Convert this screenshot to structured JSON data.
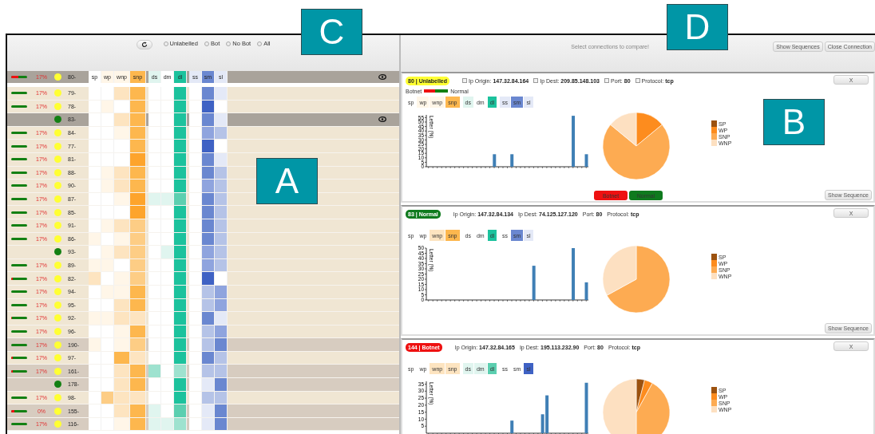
{
  "callouts": [
    {
      "label": "C"
    },
    {
      "label": "D"
    },
    {
      "label": "A"
    },
    {
      "label": "B"
    }
  ],
  "filter_bar": {
    "radios": [
      {
        "label": "Unlabelled",
        "selected": false
      },
      {
        "label": "Bot",
        "selected": false
      },
      {
        "label": "No Bot",
        "selected": false
      },
      {
        "label": "All",
        "selected": false
      }
    ]
  },
  "header_row": {
    "id": "80-",
    "percent": "17%",
    "vote": {
      "level": 0.45
    },
    "color": "#ffff33",
    "columns": [
      {
        "label": "sp",
        "color": "#ffffff"
      },
      {
        "label": "wp",
        "color": "#fff6e8"
      },
      {
        "label": "wnp",
        "color": "#fff6e8"
      },
      {
        "label": "snp",
        "color": "#fdb74e"
      },
      {
        "label": "ds",
        "color": "#e0f5ef"
      },
      {
        "label": "dm",
        "color": "#ffffff"
      },
      {
        "label": "dl",
        "color": "#1cc29d"
      },
      {
        "label": "ss",
        "color": "#e4e9f7"
      },
      {
        "label": "sm",
        "color": "#6a87d0"
      },
      {
        "label": "sl",
        "color": "#e4e9f7"
      }
    ]
  },
  "rows": [
    {
      "id": "79-",
      "percent": "17%",
      "vote": {
        "level": 0
      },
      "color": "#ffff33",
      "highlighted": false,
      "selected": false,
      "cells": [
        {
          "color": "#ffffff"
        },
        {
          "color": "#ffffff"
        },
        {
          "color": "#fde4c0"
        },
        {
          "color": "#fdb74e"
        },
        {
          "color": "#ffffff"
        },
        {
          "color": "#ffffff"
        },
        {
          "color": "#1cc29d"
        },
        {
          "color": "#ffffff"
        },
        {
          "color": "#6a87d0"
        },
        {
          "color": "#e4e9f7"
        }
      ]
    },
    {
      "id": "78-",
      "percent": "17%",
      "vote": {
        "level": 0
      },
      "color": "#ffff33",
      "highlighted": false,
      "selected": false,
      "cells": [
        {
          "color": "#ffffff"
        },
        {
          "color": "#fff6e8"
        },
        {
          "color": "#ffffff"
        },
        {
          "color": "#fdb74e"
        },
        {
          "color": "#ffffff"
        },
        {
          "color": "#ffffff"
        },
        {
          "color": "#1cc29d"
        },
        {
          "color": "#ffffff"
        },
        {
          "color": "#3f62c4"
        },
        {
          "color": "#ffffff"
        }
      ]
    },
    {
      "id": "83-",
      "color": "#138013",
      "highlighted": false,
      "selected": true,
      "cells": [
        {
          "color": "#ffffff"
        },
        {
          "color": "#ffffff"
        },
        {
          "color": "#fde4c0"
        },
        {
          "color": "#fdb74e"
        },
        {
          "color": "#ffffff"
        },
        {
          "color": "#ffffff"
        },
        {
          "color": "#1cc29d"
        },
        {
          "color": "#ffffff"
        },
        {
          "color": "#6a87d0"
        },
        {
          "color": "#e4e9f7"
        }
      ]
    },
    {
      "id": "84-",
      "percent": "17%",
      "vote": {
        "level": 0
      },
      "color": "#ffff33",
      "highlighted": false,
      "selected": false,
      "cells": [
        {
          "color": "#ffffff"
        },
        {
          "color": "#ffffff"
        },
        {
          "color": "#fff6e8"
        },
        {
          "color": "#fdb74e"
        },
        {
          "color": "#ffffff"
        },
        {
          "color": "#ffffff"
        },
        {
          "color": "#1cc29d"
        },
        {
          "color": "#ffffff"
        },
        {
          "color": "#8fa4de"
        },
        {
          "color": "#b5c3e7"
        }
      ]
    },
    {
      "id": "77-",
      "percent": "17%",
      "vote": {
        "level": 0
      },
      "color": "#ffff33",
      "highlighted": false,
      "selected": false,
      "cells": [
        {
          "color": "#ffffff"
        },
        {
          "color": "#ffffff"
        },
        {
          "color": "#ffffff"
        },
        {
          "color": "#fdb74e"
        },
        {
          "color": "#ffffff"
        },
        {
          "color": "#ffffff"
        },
        {
          "color": "#1cc29d"
        },
        {
          "color": "#ffffff"
        },
        {
          "color": "#3f62c4"
        },
        {
          "color": "#ffffff"
        }
      ]
    },
    {
      "id": "81-",
      "percent": "17%",
      "vote": {
        "level": 0
      },
      "color": "#ffff33",
      "highlighted": false,
      "selected": false,
      "cells": [
        {
          "color": "#ffffff"
        },
        {
          "color": "#ffffff"
        },
        {
          "color": "#ffffff"
        },
        {
          "color": "#fda42c"
        },
        {
          "color": "#ffffff"
        },
        {
          "color": "#ffffff"
        },
        {
          "color": "#1cc29d"
        },
        {
          "color": "#ffffff"
        },
        {
          "color": "#6a87d0"
        },
        {
          "color": "#e4e9f7"
        }
      ]
    },
    {
      "id": "88-",
      "percent": "17%",
      "vote": {
        "level": 0
      },
      "color": "#ffff33",
      "highlighted": false,
      "selected": false,
      "cells": [
        {
          "color": "#ffffff"
        },
        {
          "color": "#fff6e8"
        },
        {
          "color": "#fde4c0"
        },
        {
          "color": "#fdb74e"
        },
        {
          "color": "#ffffff"
        },
        {
          "color": "#ffffff"
        },
        {
          "color": "#1cc29d"
        },
        {
          "color": "#ffffff"
        },
        {
          "color": "#6a87d0"
        },
        {
          "color": "#b5c3e7"
        }
      ]
    },
    {
      "id": "90-",
      "percent": "17%",
      "vote": {
        "level": 0
      },
      "color": "#ffff33",
      "highlighted": false,
      "selected": false,
      "cells": [
        {
          "color": "#ffffff"
        },
        {
          "color": "#fff6e8"
        },
        {
          "color": "#fde4c0"
        },
        {
          "color": "#fdb74e"
        },
        {
          "color": "#ffffff"
        },
        {
          "color": "#ffffff"
        },
        {
          "color": "#1cc29d"
        },
        {
          "color": "#ffffff"
        },
        {
          "color": "#8fa4de"
        },
        {
          "color": "#b5c3e7"
        }
      ]
    },
    {
      "id": "87-",
      "percent": "17%",
      "vote": {
        "level": 0
      },
      "color": "#ffff33",
      "highlighted": false,
      "selected": false,
      "cells": [
        {
          "color": "#ffffff"
        },
        {
          "color": "#ffffff"
        },
        {
          "color": "#fff6e8"
        },
        {
          "color": "#fda42c"
        },
        {
          "color": "#e0f5ef"
        },
        {
          "color": "#e0f5ef"
        },
        {
          "color": "#5ccfb0"
        },
        {
          "color": "#ffffff"
        },
        {
          "color": "#6a87d0"
        },
        {
          "color": "#b5c3e7"
        }
      ]
    },
    {
      "id": "85-",
      "percent": "17%",
      "vote": {
        "level": 0
      },
      "color": "#ffff33",
      "highlighted": false,
      "selected": false,
      "cells": [
        {
          "color": "#ffffff"
        },
        {
          "color": "#ffffff"
        },
        {
          "color": "#ffffff"
        },
        {
          "color": "#fda42c"
        },
        {
          "color": "#ffffff"
        },
        {
          "color": "#ffffff"
        },
        {
          "color": "#1cc29d"
        },
        {
          "color": "#ffffff"
        },
        {
          "color": "#6a87d0"
        },
        {
          "color": "#b5c3e7"
        }
      ]
    },
    {
      "id": "91-",
      "percent": "17%",
      "vote": {
        "level": 0
      },
      "color": "#ffff33",
      "highlighted": false,
      "selected": false,
      "cells": [
        {
          "color": "#ffffff"
        },
        {
          "color": "#fff6e8"
        },
        {
          "color": "#fde4c0"
        },
        {
          "color": "#fdcd85"
        },
        {
          "color": "#ffffff"
        },
        {
          "color": "#ffffff"
        },
        {
          "color": "#1cc29d"
        },
        {
          "color": "#ffffff"
        },
        {
          "color": "#6a87d0"
        },
        {
          "color": "#b5c3e7"
        }
      ]
    },
    {
      "id": "86-",
      "percent": "17%",
      "vote": {
        "level": 0
      },
      "color": "#ffff33",
      "highlighted": false,
      "selected": false,
      "cells": [
        {
          "color": "#fff6e8"
        },
        {
          "color": "#ffffff"
        },
        {
          "color": "#fff6e8"
        },
        {
          "color": "#fdcd85"
        },
        {
          "color": "#ffffff"
        },
        {
          "color": "#ffffff"
        },
        {
          "color": "#1cc29d"
        },
        {
          "color": "#ffffff"
        },
        {
          "color": "#6a87d0"
        },
        {
          "color": "#b5c3e7"
        }
      ]
    },
    {
      "id": "93-",
      "color": "#138013",
      "highlighted": false,
      "selected": false,
      "cells": [
        {
          "color": "#ffffff"
        },
        {
          "color": "#fff6e8"
        },
        {
          "color": "#fde4c0"
        },
        {
          "color": "#fdcd85"
        },
        {
          "color": "#ffffff"
        },
        {
          "color": "#e0f5ef"
        },
        {
          "color": "#1cc29d"
        },
        {
          "color": "#ffffff"
        },
        {
          "color": "#8fa4de"
        },
        {
          "color": "#b5c3e7"
        }
      ]
    },
    {
      "id": "89-",
      "percent": "17%",
      "vote": {
        "level": 0
      },
      "color": "#ffff33",
      "highlighted": false,
      "selected": false,
      "cells": [
        {
          "color": "#fff6e8"
        },
        {
          "color": "#fff6e8"
        },
        {
          "color": "#ffffff"
        },
        {
          "color": "#fdcd85"
        },
        {
          "color": "#ffffff"
        },
        {
          "color": "#ffffff"
        },
        {
          "color": "#1cc29d"
        },
        {
          "color": "#ffffff"
        },
        {
          "color": "#8fa4de"
        },
        {
          "color": "#b5c3e7"
        }
      ]
    },
    {
      "id": "82-",
      "percent": "17%",
      "vote": {
        "level": 0.1
      },
      "color": "#ffff33",
      "highlighted": false,
      "selected": false,
      "cells": [
        {
          "color": "#fde4c0"
        },
        {
          "color": "#ffffff"
        },
        {
          "color": "#fff6e8"
        },
        {
          "color": "#fdcd85"
        },
        {
          "color": "#ffffff"
        },
        {
          "color": "#ffffff"
        },
        {
          "color": "#1cc29d"
        },
        {
          "color": "#ffffff"
        },
        {
          "color": "#3f62c4"
        },
        {
          "color": "#ffffff"
        }
      ]
    },
    {
      "id": "94-",
      "percent": "17%",
      "vote": {
        "level": 0
      },
      "color": "#ffff33",
      "highlighted": false,
      "selected": false,
      "cells": [
        {
          "color": "#ffffff"
        },
        {
          "color": "#fff6e8"
        },
        {
          "color": "#fff6e8"
        },
        {
          "color": "#fdb74e"
        },
        {
          "color": "#ffffff"
        },
        {
          "color": "#ffffff"
        },
        {
          "color": "#1cc29d"
        },
        {
          "color": "#ffffff"
        },
        {
          "color": "#b5c3e7"
        },
        {
          "color": "#8fa4de"
        }
      ]
    },
    {
      "id": "95-",
      "percent": "17%",
      "vote": {
        "level": 0
      },
      "color": "#ffff33",
      "highlighted": false,
      "selected": false,
      "cells": [
        {
          "color": "#ffffff"
        },
        {
          "color": "#ffffff"
        },
        {
          "color": "#fde4c0"
        },
        {
          "color": "#fdb74e"
        },
        {
          "color": "#ffffff"
        },
        {
          "color": "#ffffff"
        },
        {
          "color": "#1cc29d"
        },
        {
          "color": "#ffffff"
        },
        {
          "color": "#b5c3e7"
        },
        {
          "color": "#8fa4de"
        }
      ]
    },
    {
      "id": "92-",
      "percent": "17%",
      "vote": {
        "level": 0.05
      },
      "color": "#ffff33",
      "highlighted": false,
      "selected": false,
      "cells": [
        {
          "color": "#fff6e8"
        },
        {
          "color": "#fff6e8"
        },
        {
          "color": "#fde4c0"
        },
        {
          "color": "#fde4c0"
        },
        {
          "color": "#ffffff"
        },
        {
          "color": "#ffffff"
        },
        {
          "color": "#1cc29d"
        },
        {
          "color": "#ffffff"
        },
        {
          "color": "#6a87d0"
        },
        {
          "color": "#e4e9f7"
        }
      ]
    },
    {
      "id": "96-",
      "percent": "17%",
      "vote": {
        "level": 0
      },
      "color": "#ffff33",
      "highlighted": false,
      "selected": false,
      "cells": [
        {
          "color": "#ffffff"
        },
        {
          "color": "#ffffff"
        },
        {
          "color": "#fff6e8"
        },
        {
          "color": "#fdb74e"
        },
        {
          "color": "#ffffff"
        },
        {
          "color": "#ffffff"
        },
        {
          "color": "#1cc29d"
        },
        {
          "color": "#ffffff"
        },
        {
          "color": "#b5c3e7"
        },
        {
          "color": "#8fa4de"
        }
      ]
    },
    {
      "id": "190-",
      "percent": "17%",
      "vote": {
        "level": 0
      },
      "color": "#ffff33",
      "highlighted": true,
      "selected": false,
      "cells": [
        {
          "color": "#fff6e8"
        },
        {
          "color": "#ffffff"
        },
        {
          "color": "#fff6e8"
        },
        {
          "color": "#fdcd85"
        },
        {
          "color": "#ffffff"
        },
        {
          "color": "#ffffff"
        },
        {
          "color": "#1cc29d"
        },
        {
          "color": "#ffffff"
        },
        {
          "color": "#b5c3e7"
        },
        {
          "color": "#6a87d0"
        }
      ]
    },
    {
      "id": "97-",
      "percent": "17%",
      "vote": {
        "level": 0.1
      },
      "color": "#ffff33",
      "highlighted": false,
      "selected": false,
      "cells": [
        {
          "color": "#ffffff"
        },
        {
          "color": "#ffffff"
        },
        {
          "color": "#fdb74e"
        },
        {
          "color": "#fde4c0"
        },
        {
          "color": "#ffffff"
        },
        {
          "color": "#ffffff"
        },
        {
          "color": "#1cc29d"
        },
        {
          "color": "#ffffff"
        },
        {
          "color": "#6a87d0"
        },
        {
          "color": "#b5c3e7"
        }
      ]
    },
    {
      "id": "161-",
      "percent": "17%",
      "vote": {
        "level": 0.1
      },
      "color": "#ffff33",
      "highlighted": true,
      "selected": false,
      "cells": [
        {
          "color": "#ffffff"
        },
        {
          "color": "#ffffff"
        },
        {
          "color": "#fde4c0"
        },
        {
          "color": "#fdb74e"
        },
        {
          "color": "#9ee2cf"
        },
        {
          "color": "#ffffff"
        },
        {
          "color": "#9ee2cf"
        },
        {
          "color": "#ffffff"
        },
        {
          "color": "#b5c3e7"
        },
        {
          "color": "#b5c3e7"
        }
      ]
    },
    {
      "id": "178-",
      "color": "#138013",
      "highlighted": true,
      "selected": false,
      "cells": [
        {
          "color": "#ffffff"
        },
        {
          "color": "#ffffff"
        },
        {
          "color": "#fde4c0"
        },
        {
          "color": "#fdb74e"
        },
        {
          "color": "#ffffff"
        },
        {
          "color": "#ffffff"
        },
        {
          "color": "#1cc29d"
        },
        {
          "color": "#ffffff"
        },
        {
          "color": "#e4e9f7"
        },
        {
          "color": "#6a87d0"
        }
      ]
    },
    {
      "id": "98-",
      "percent": "17%",
      "vote": {
        "level": 0
      },
      "color": "#ffff33",
      "highlighted": false,
      "selected": false,
      "cells": [
        {
          "color": "#ffffff"
        },
        {
          "color": "#fdcd85"
        },
        {
          "color": "#fde4c0"
        },
        {
          "color": "#fde4c0"
        },
        {
          "color": "#ffffff"
        },
        {
          "color": "#ffffff"
        },
        {
          "color": "#1cc29d"
        },
        {
          "color": "#ffffff"
        },
        {
          "color": "#b5c3e7"
        },
        {
          "color": "#b5c3e7"
        }
      ]
    },
    {
      "id": "155-",
      "percent": "0%",
      "vote": {
        "level": 0.2
      },
      "color": "#ffff33",
      "highlighted": true,
      "selected": false,
      "cells": [
        {
          "color": "#ffffff"
        },
        {
          "color": "#ffffff"
        },
        {
          "color": "#fde4c0"
        },
        {
          "color": "#fdb74e"
        },
        {
          "color": "#e0f5ef"
        },
        {
          "color": "#ffffff"
        },
        {
          "color": "#5ccfb0"
        },
        {
          "color": "#ffffff"
        },
        {
          "color": "#e4e9f7"
        },
        {
          "color": "#6a87d0"
        }
      ]
    },
    {
      "id": "116-",
      "percent": "17%",
      "vote": {
        "level": 0
      },
      "color": "#ffff33",
      "highlighted": true,
      "selected": false,
      "cells": [
        {
          "color": "#ffffff"
        },
        {
          "color": "#ffffff"
        },
        {
          "color": "#fff6e8"
        },
        {
          "color": "#fdb74e"
        },
        {
          "color": "#e0f5ef"
        },
        {
          "color": "#e0f5ef"
        },
        {
          "color": "#9ee2cf"
        },
        {
          "color": "#ffffff"
        },
        {
          "color": "#e4e9f7"
        },
        {
          "color": "#6a87d0"
        }
      ]
    }
  ],
  "compare_bar": {
    "message": "Select connections to compare!",
    "buttons": [
      "Show Sequences",
      "Close Connection"
    ]
  },
  "connections": [
    {
      "badge": "80 | Unlabelled",
      "color": "#ffff33",
      "fields": [
        {
          "label": "Ip Origin:",
          "value": "147.32.84.164",
          "checked": false
        },
        {
          "label": "Ip Dest:",
          "value": "209.85.148.103",
          "checked": false
        },
        {
          "label": "Port:",
          "value": "80",
          "checked": false
        },
        {
          "label": "Protocol:",
          "value": "tcp",
          "checked": false
        }
      ],
      "close": "X",
      "vote_legend": {
        "left": "Botnet",
        "right": "Normal",
        "level": 0.45
      },
      "tags": [
        {
          "label": "sp",
          "color": "#ffffff"
        },
        {
          "label": "wp",
          "color": "#fff6e8"
        },
        {
          "label": "wnp",
          "color": "#fff6e8"
        },
        {
          "label": "snp",
          "color": "#fdb74e"
        },
        {
          "label": "ds",
          "color": "#e0f5ef"
        },
        {
          "label": "dm",
          "color": "#ffffff"
        },
        {
          "label": "dl",
          "color": "#1cc29d"
        },
        {
          "label": "ss",
          "color": "#e4e9f7"
        },
        {
          "label": "sm",
          "color": "#6a87d0"
        },
        {
          "label": "sl",
          "color": "#e4e9f7"
        }
      ],
      "bar_chart": {
        "chart_data": {
          "type": "bar",
          "ylabel": "Letter (%)",
          "values": [
            0,
            0,
            0,
            0,
            0,
            0,
            0,
            0,
            0,
            0,
            0,
            0,
            0,
            0,
            0,
            14,
            0,
            0,
            0,
            14,
            0,
            0,
            0,
            0,
            0,
            0,
            0,
            0,
            0,
            0,
            0,
            0,
            0,
            57,
            0,
            0,
            14
          ],
          "ylim": [
            0,
            58
          ],
          "yticks": [
            0,
            5,
            10,
            15,
            20,
            25,
            30,
            35,
            40,
            45,
            50,
            55
          ]
        }
      },
      "pie_chart": {
        "chart_data": {
          "type": "pie",
          "categories": [
            "SP",
            "WP",
            "SNP",
            "WNP"
          ],
          "values": [
            0,
            14,
            72,
            14
          ],
          "colors": [
            "#9c520f",
            "#fd8c1e",
            "#fdab52",
            "#fde0c1"
          ]
        }
      },
      "vote_buttons": [
        {
          "label": "Botnet",
          "color": "#ee1111"
        },
        {
          "label": "Normal",
          "color": "#0f7a1e"
        }
      ],
      "show_sequence": "Show Sequence"
    },
    {
      "badge": "83 | Normal",
      "color": "#0f7a1e",
      "fields": [
        {
          "label": "Ip Origin:",
          "value": "147.32.84.134"
        },
        {
          "label": "Ip Dest:",
          "value": "74.125.127.120"
        },
        {
          "label": "Port:",
          "value": "80"
        },
        {
          "label": "Protocol:",
          "value": "tcp"
        }
      ],
      "close": "X",
      "tags": [
        {
          "label": "sp",
          "color": "#ffffff"
        },
        {
          "label": "wp",
          "color": "#ffffff"
        },
        {
          "label": "wnp",
          "color": "#fde4c0"
        },
        {
          "label": "snp",
          "color": "#fdb74e"
        },
        {
          "label": "ds",
          "color": "#ffffff"
        },
        {
          "label": "dm",
          "color": "#ffffff"
        },
        {
          "label": "dl",
          "color": "#1cc29d"
        },
        {
          "label": "ss",
          "color": "#ffffff"
        },
        {
          "label": "sm",
          "color": "#6a87d0"
        },
        {
          "label": "sl",
          "color": "#e4e9f7"
        }
      ],
      "bar_chart": {
        "chart_data": {
          "type": "bar",
          "ylabel": "Letter (%)",
          "values": [
            0,
            0,
            0,
            0,
            0,
            0,
            0,
            0,
            0,
            0,
            0,
            0,
            0,
            0,
            0,
            0,
            0,
            0,
            0,
            0,
            0,
            0,
            0,
            0,
            33,
            0,
            0,
            0,
            0,
            0,
            0,
            0,
            0,
            50,
            0,
            0,
            17
          ],
          "ylim": [
            0,
            50
          ],
          "yticks": [
            0,
            5,
            10,
            15,
            20,
            25,
            30,
            35,
            40,
            45,
            50
          ]
        }
      },
      "pie_chart": {
        "chart_data": {
          "type": "pie",
          "categories": [
            "SP",
            "WP",
            "SNP",
            "WNP"
          ],
          "values": [
            0,
            0,
            67,
            33
          ],
          "colors": [
            "#9c520f",
            "#fd8c1e",
            "#fdab52",
            "#fde0c1"
          ]
        }
      },
      "show_sequence": "Show Sequence"
    },
    {
      "badge": "144 | Botnet",
      "color": "#ee1111",
      "fields": [
        {
          "label": "Ip Origin:",
          "value": "147.32.84.165"
        },
        {
          "label": "Ip Dest:",
          "value": "195.113.232.90"
        },
        {
          "label": "Port:",
          "value": "80"
        },
        {
          "label": "Protocol:",
          "value": "tcp"
        }
      ],
      "close": "X",
      "tags": [
        {
          "label": "sp",
          "color": "#ffffff"
        },
        {
          "label": "wp",
          "color": "#ffffff"
        },
        {
          "label": "wnp",
          "color": "#fde4c0"
        },
        {
          "label": "snp",
          "color": "#fde4c0"
        },
        {
          "label": "ds",
          "color": "#e0f5ef"
        },
        {
          "label": "dm",
          "color": "#e0f5ef"
        },
        {
          "label": "dl",
          "color": "#5ccfb0"
        },
        {
          "label": "ss",
          "color": "#ffffff"
        },
        {
          "label": "sm",
          "color": "#ffffff"
        },
        {
          "label": "sl",
          "color": "#3f62c4"
        }
      ],
      "bar_chart": {
        "chart_data": {
          "type": "bar",
          "ylabel": "Letter (%)",
          "values": [
            0,
            0,
            0,
            0,
            0,
            0,
            0,
            0,
            0,
            0,
            0,
            0,
            0,
            0,
            0,
            0,
            0,
            0,
            0,
            9,
            0,
            0,
            0,
            0,
            0,
            0,
            13.5,
            27,
            0,
            0,
            0,
            0,
            0,
            0,
            0,
            0,
            36
          ],
          "ylim": [
            0,
            37
          ],
          "yticks": [
            5,
            10,
            15,
            20,
            25,
            30,
            35
          ]
        }
      },
      "pie_chart": {
        "chart_data": {
          "type": "pie",
          "categories": [
            "SP",
            "WP",
            "SNP",
            "WNP"
          ],
          "values": [
            4,
            4,
            42,
            50
          ],
          "colors": [
            "#9c520f",
            "#fd8c1e",
            "#fdab52",
            "#fde0c1"
          ]
        }
      }
    }
  ]
}
